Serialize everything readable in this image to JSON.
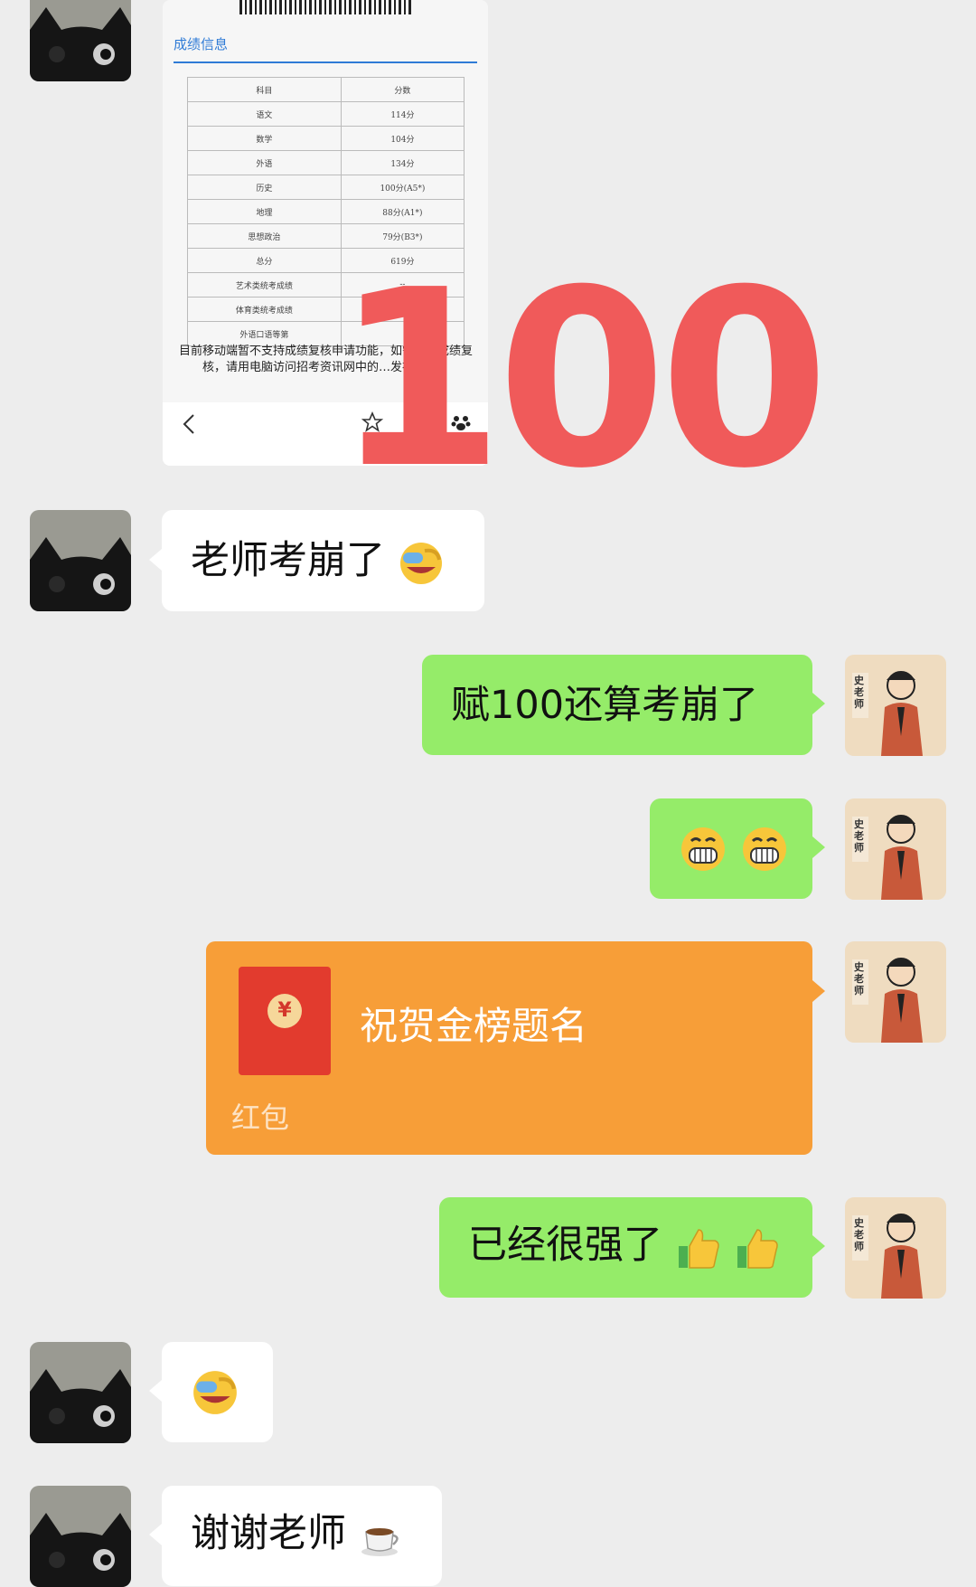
{
  "score_screenshot": {
    "qr_caption": "",
    "section_title": "成绩信息",
    "headers": [
      "科目",
      "分数"
    ],
    "rows": [
      [
        "语文",
        "114分"
      ],
      [
        "数学",
        "104分"
      ],
      [
        "外语",
        "134分"
      ],
      [
        "历史",
        "100分(A5*)"
      ],
      [
        "地理",
        "88分(A1*)"
      ],
      [
        "思想政治",
        "79分(B3*)"
      ],
      [
        "总分",
        "619分"
      ],
      [
        "艺术类统考成绩",
        "--"
      ],
      [
        "体育类统考成绩",
        ""
      ],
      [
        "外语口语等第",
        ""
      ]
    ],
    "note": "目前移动端暂不支持成绩复核申请功能，如需申请成绩复核，请用电脑访问招考资讯网中的…发布功能。",
    "overlay_number": "100"
  },
  "messages": [
    {
      "side": "left",
      "text": "老师考崩了",
      "emoji": "facepalm"
    },
    {
      "side": "right",
      "text": "赋100还算考崩了"
    },
    {
      "side": "right",
      "text": "",
      "emoji": "grin grin"
    },
    {
      "side": "right",
      "type": "red_packet",
      "title": "祝贺金榜题名",
      "label": "红包"
    },
    {
      "side": "right",
      "text": "已经很强了",
      "emoji": "thumbs-up thumbs-up"
    },
    {
      "side": "left",
      "text": "",
      "emoji": "facepalm"
    },
    {
      "side": "left",
      "text": "谢谢老师",
      "emoji": "coffee"
    }
  ],
  "teacher_avatar": {
    "badge": "史老师"
  },
  "colors": {
    "background": "#ededed",
    "sent_bubble": "#95ec69",
    "received_bubble": "#ffffff",
    "red_packet": "#f79e38",
    "overlay": "#f05a5a"
  }
}
